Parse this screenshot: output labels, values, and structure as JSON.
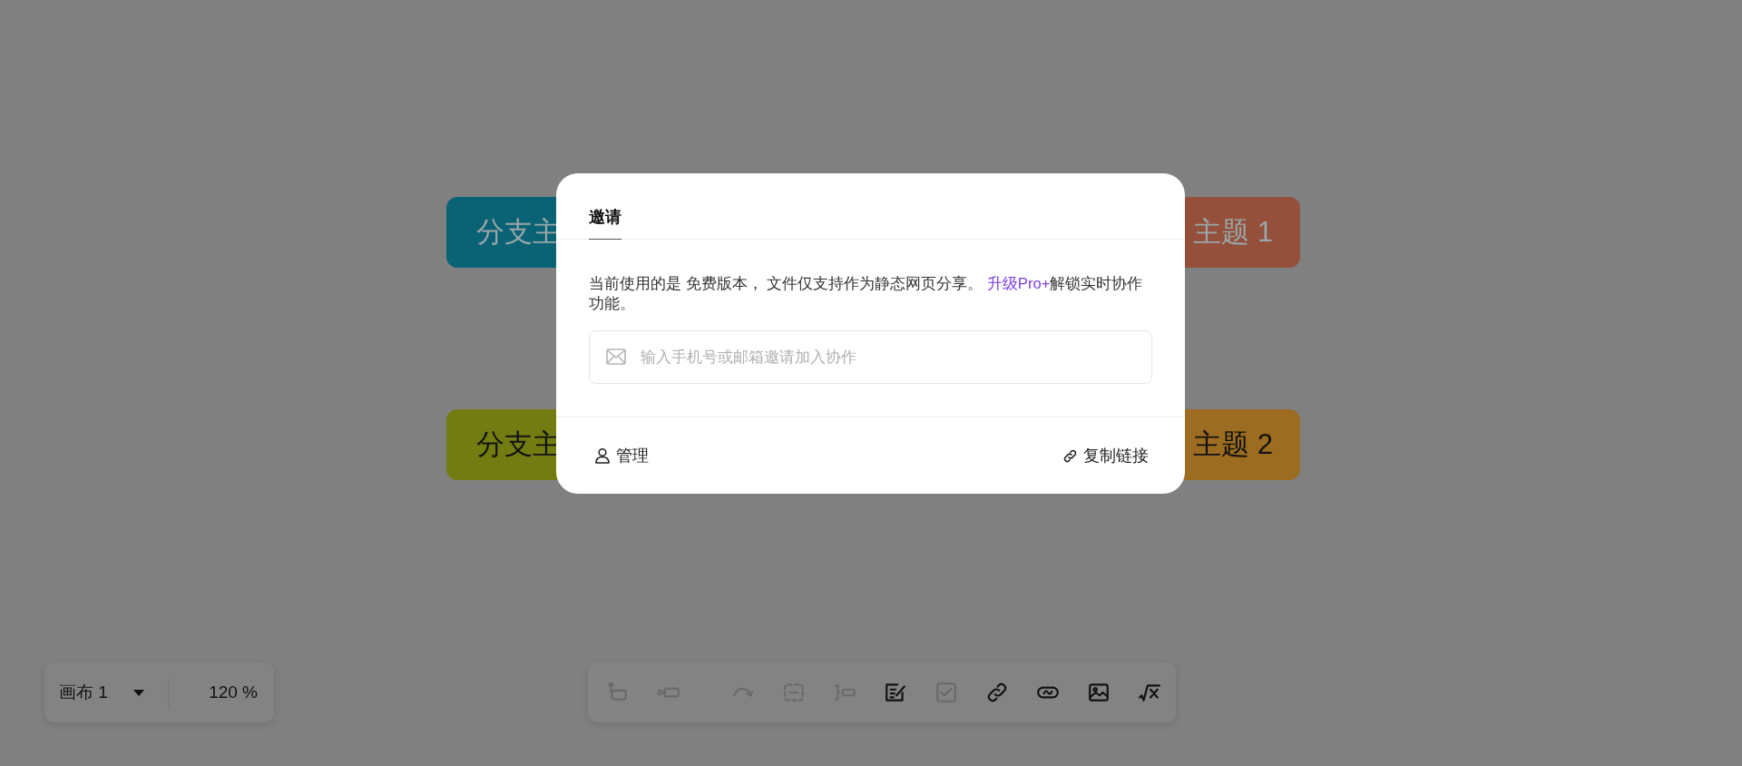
{
  "canvas": {
    "topics": [
      {
        "text": "分支主",
        "color": "#0a6275",
        "kind": "left"
      },
      {
        "text": "主题 1",
        "color": "#94503a",
        "kind": "right"
      },
      {
        "text": "分支主",
        "color": "#727c10",
        "kind": "left"
      },
      {
        "text": "主题 2",
        "color": "#9c6d20",
        "kind": "right"
      }
    ]
  },
  "invite_dialog": {
    "tabs": [
      {
        "label": "邀请",
        "selected": true
      }
    ],
    "notice": {
      "text_before": "当前使用的是 免费版本， 文件仅支持作为静态网页分享。 ",
      "link": "升级Pro+",
      "text_after": "解锁实时协作功能。"
    },
    "invite_field": {
      "placeholder": "输入手机号或邮箱邀请加入协作"
    },
    "manage_button": "管理",
    "copy_link_button": "复制链接"
  },
  "canvas_panel": {
    "canvas_name": "画布 1",
    "zoom": "120 %"
  },
  "toolbar": {
    "groups": [
      [
        {
          "kind": "child",
          "disabled": true
        },
        {
          "kind": "sibling",
          "disabled": true
        }
      ],
      [
        {
          "kind": "relation",
          "disabled": true
        },
        {
          "kind": "summary-box",
          "disabled": true
        },
        {
          "kind": "bracket",
          "disabled": true
        },
        {
          "kind": "note",
          "disabled": false
        },
        {
          "kind": "task",
          "disabled": true
        },
        {
          "kind": "link",
          "disabled": false
        },
        {
          "kind": "tag",
          "disabled": false
        },
        {
          "kind": "image",
          "disabled": false
        },
        {
          "kind": "formula",
          "disabled": false
        }
      ]
    ]
  }
}
